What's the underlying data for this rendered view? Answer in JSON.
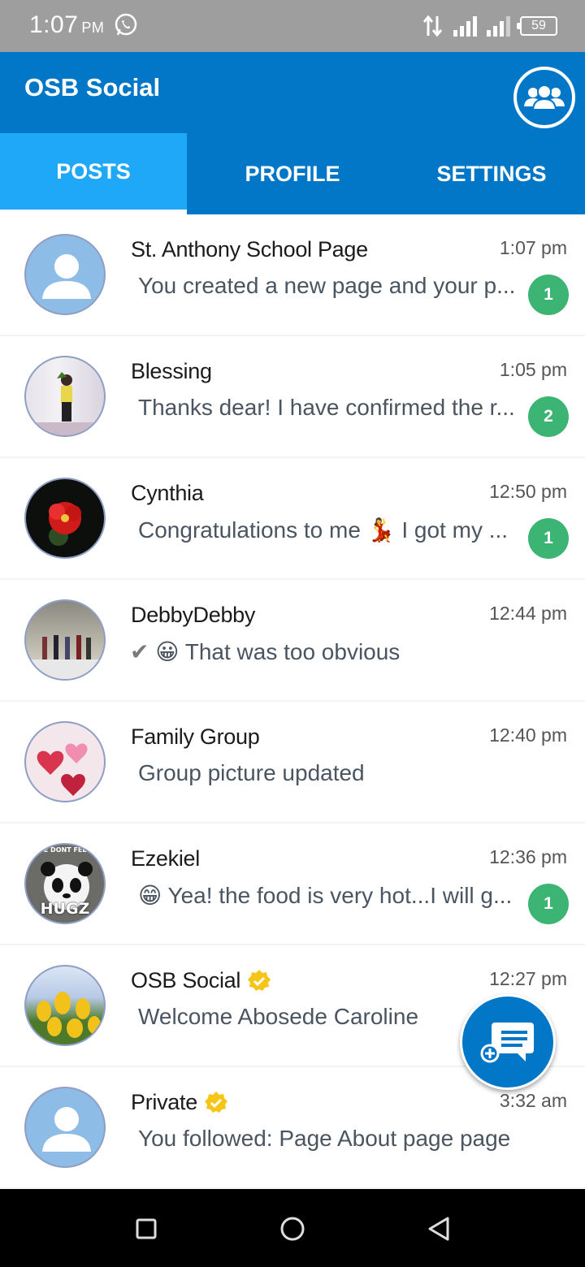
{
  "status_bar": {
    "time": "1:07",
    "ampm": "PM",
    "battery": "59"
  },
  "app": {
    "title": "OSB Social",
    "accent": "#0277c8",
    "tab_active_bg": "#1ea8f7",
    "badge_color": "#3cb473"
  },
  "tabs": [
    {
      "label": "POSTS",
      "active": true
    },
    {
      "label": "PROFILE",
      "active": false
    },
    {
      "label": "SETTINGS",
      "active": false
    }
  ],
  "chats": [
    {
      "name": "St. Anthony School Page",
      "time": "1:07 pm",
      "message": "You created a new page and your p...",
      "unread": "1",
      "avatar": "default-avatar"
    },
    {
      "name": "Blessing",
      "time": "1:05 pm",
      "message": "Thanks dear! I have confirmed the r...",
      "unread": "2",
      "avatar": "photo-woman"
    },
    {
      "name": "Cynthia",
      "time": "12:50 pm",
      "message": "Congratulations to me 💃 I got my ...",
      "unread": "1",
      "avatar": "photo-red-flower"
    },
    {
      "name": "DebbyDebby",
      "time": "12:44 pm",
      "message": "😀 That was too obvious",
      "unread": "",
      "avatar": "photo-group",
      "sent_check": true
    },
    {
      "name": "Family Group",
      "time": "12:40 pm",
      "message": "Group picture updated",
      "unread": "",
      "avatar": "photo-hearts"
    },
    {
      "name": "Ezekiel",
      "time": "12:36 pm",
      "message": "😁 Yea! the food is very hot...I will g...",
      "unread": "1",
      "avatar": "photo-panda",
      "avatar_text": {
        "top": "SE DONT FEEL",
        "bottom": "HUGZ"
      }
    },
    {
      "name": "OSB Social",
      "time": "12:27 pm",
      "message": "Welcome Abosede Caroline",
      "unread": "",
      "avatar": "photo-tulips",
      "verified": true
    },
    {
      "name": "Private",
      "time": "3:32 am",
      "message": "You followed: Page About page page",
      "unread": "",
      "avatar": "default-avatar",
      "verified": true
    }
  ],
  "icons": {
    "group": "group-icon",
    "fab": "new-chat-icon",
    "nav": [
      "square-icon",
      "circle-icon",
      "back-triangle-icon"
    ]
  }
}
